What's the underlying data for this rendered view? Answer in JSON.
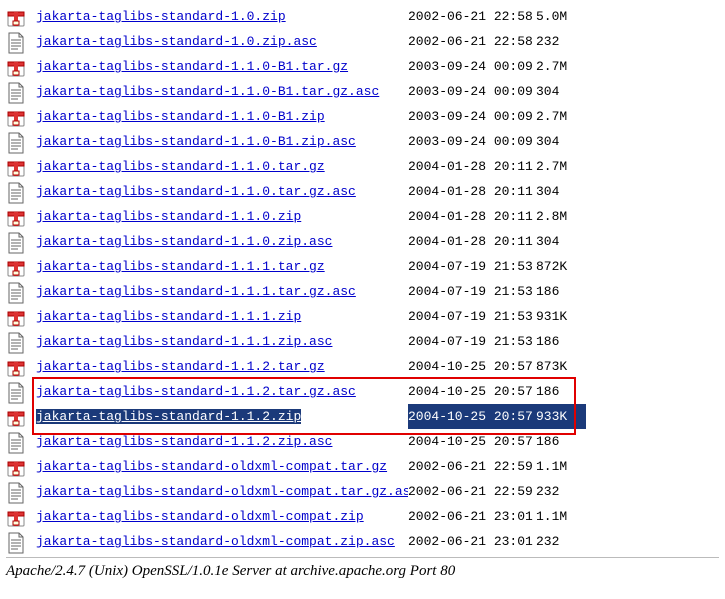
{
  "footer": "Apache/2.4.7 (Unix) OpenSSL/1.0.1e Server at archive.apache.org Port 80",
  "files": [
    {
      "name": "jakarta-taglibs-standard-1.0.zip",
      "date": "2002-06-21 22:58",
      "size": "5.0M",
      "icon": "archive"
    },
    {
      "name": "jakarta-taglibs-standard-1.0.zip.asc",
      "date": "2002-06-21 22:58",
      "size": "232",
      "icon": "text"
    },
    {
      "name": "jakarta-taglibs-standard-1.1.0-B1.tar.gz",
      "date": "2003-09-24 00:09",
      "size": "2.7M",
      "icon": "archive"
    },
    {
      "name": "jakarta-taglibs-standard-1.1.0-B1.tar.gz.asc",
      "date": "2003-09-24 00:09",
      "size": "304",
      "icon": "text"
    },
    {
      "name": "jakarta-taglibs-standard-1.1.0-B1.zip",
      "date": "2003-09-24 00:09",
      "size": "2.7M",
      "icon": "archive"
    },
    {
      "name": "jakarta-taglibs-standard-1.1.0-B1.zip.asc",
      "date": "2003-09-24 00:09",
      "size": "304",
      "icon": "text"
    },
    {
      "name": "jakarta-taglibs-standard-1.1.0.tar.gz",
      "date": "2004-01-28 20:11",
      "size": "2.7M",
      "icon": "archive"
    },
    {
      "name": "jakarta-taglibs-standard-1.1.0.tar.gz.asc",
      "date": "2004-01-28 20:11",
      "size": "304",
      "icon": "text"
    },
    {
      "name": "jakarta-taglibs-standard-1.1.0.zip",
      "date": "2004-01-28 20:11",
      "size": "2.8M",
      "icon": "archive"
    },
    {
      "name": "jakarta-taglibs-standard-1.1.0.zip.asc",
      "date": "2004-01-28 20:11",
      "size": "304",
      "icon": "text"
    },
    {
      "name": "jakarta-taglibs-standard-1.1.1.tar.gz",
      "date": "2004-07-19 21:53",
      "size": "872K",
      "icon": "archive"
    },
    {
      "name": "jakarta-taglibs-standard-1.1.1.tar.gz.asc",
      "date": "2004-07-19 21:53",
      "size": "186",
      "icon": "text"
    },
    {
      "name": "jakarta-taglibs-standard-1.1.1.zip",
      "date": "2004-07-19 21:53",
      "size": "931K",
      "icon": "archive"
    },
    {
      "name": "jakarta-taglibs-standard-1.1.1.zip.asc",
      "date": "2004-07-19 21:53",
      "size": "186",
      "icon": "text"
    },
    {
      "name": "jakarta-taglibs-standard-1.1.2.tar.gz",
      "date": "2004-10-25 20:57",
      "size": "873K",
      "icon": "archive"
    },
    {
      "name": "jakarta-taglibs-standard-1.1.2.tar.gz.asc",
      "date": "2004-10-25 20:57",
      "size": "186",
      "icon": "text"
    },
    {
      "name": "jakarta-taglibs-standard-1.1.2.zip",
      "date": "2004-10-25 20:57",
      "size": "933K",
      "icon": "archive",
      "highlight": true
    },
    {
      "name": "jakarta-taglibs-standard-1.1.2.zip.asc",
      "date": "2004-10-25 20:57",
      "size": "186",
      "icon": "text"
    },
    {
      "name": "jakarta-taglibs-standard-oldxml-compat.tar.gz",
      "date": "2002-06-21 22:59",
      "size": "1.1M",
      "icon": "archive"
    },
    {
      "name": "jakarta-taglibs-standard-oldxml-compat.tar.gz.asc",
      "date": "2002-06-21 22:59",
      "size": "232",
      "icon": "text"
    },
    {
      "name": "jakarta-taglibs-standard-oldxml-compat.zip",
      "date": "2002-06-21 23:01",
      "size": "1.1M",
      "icon": "archive"
    },
    {
      "name": "jakarta-taglibs-standard-oldxml-compat.zip.asc",
      "date": "2002-06-21 23:01",
      "size": "232",
      "icon": "text"
    }
  ],
  "redbox": {
    "fromRow": 15,
    "toRow": 16
  }
}
